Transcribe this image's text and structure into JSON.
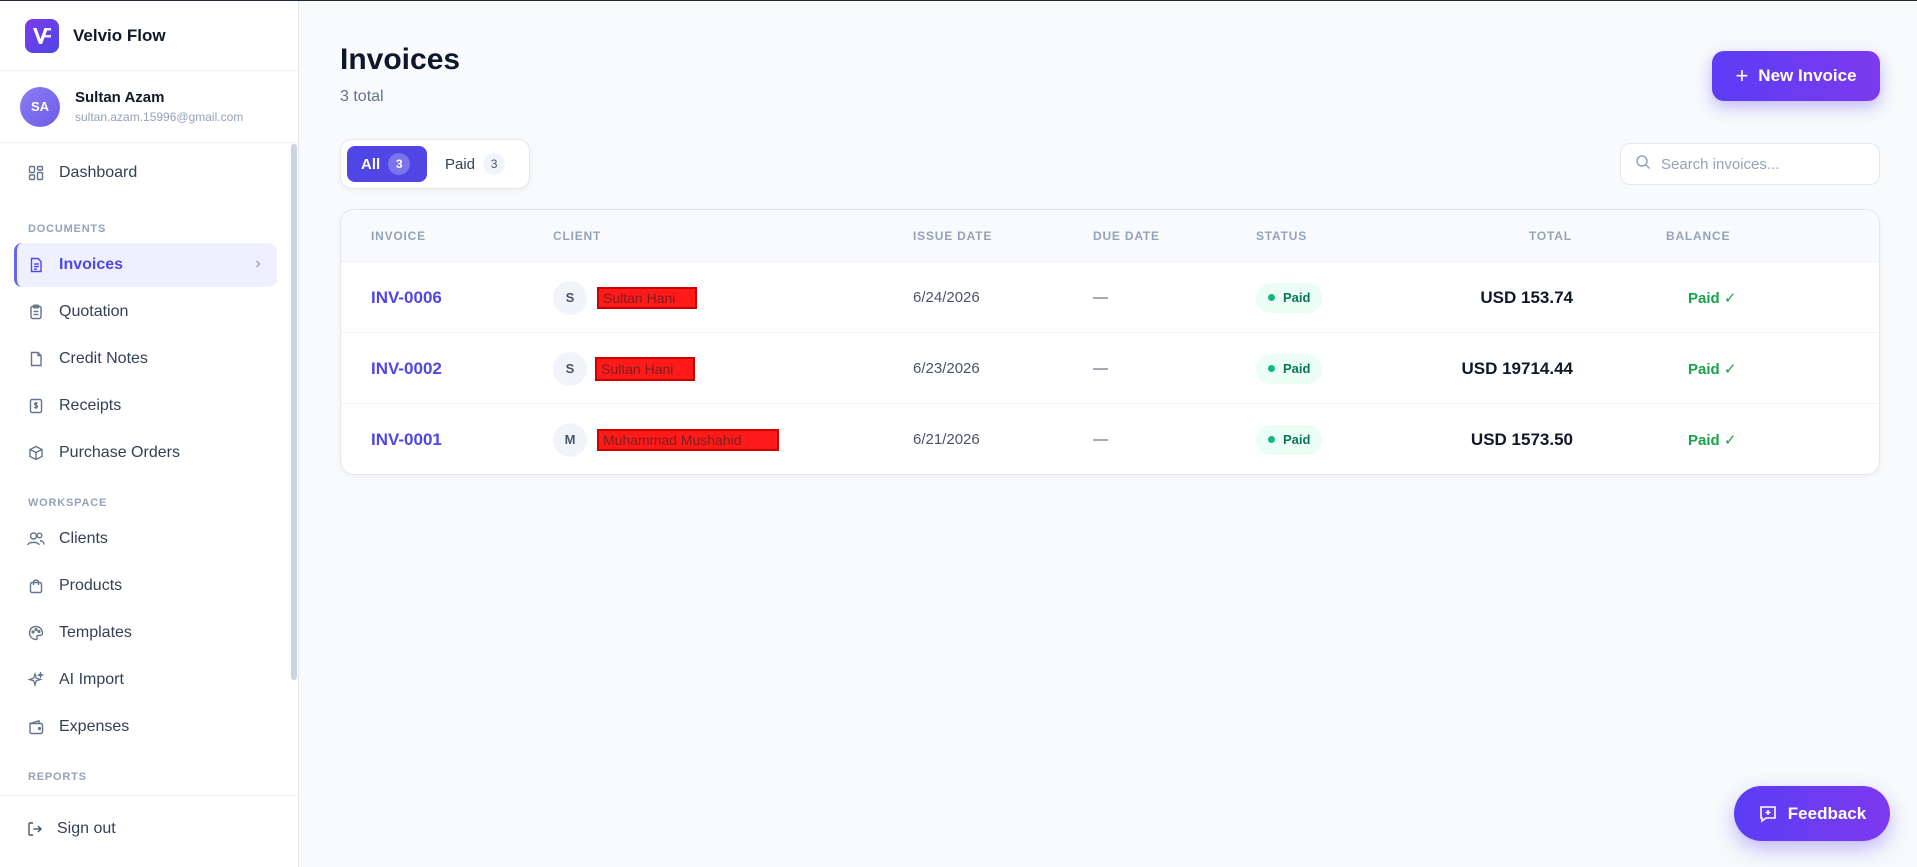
{
  "app": {
    "name": "Velvio Flow"
  },
  "user": {
    "initials": "SA",
    "name": "Sultan Azam",
    "email": "sultan.azam.15996@gmail.com"
  },
  "sidebar": {
    "dashboard": "Dashboard",
    "documents_label": "DOCUMENTS",
    "documents": [
      "Invoices",
      "Quotation",
      "Credit Notes",
      "Receipts",
      "Purchase Orders"
    ],
    "workspace_label": "WORKSPACE",
    "workspace": [
      "Clients",
      "Products",
      "Templates",
      "AI Import",
      "Expenses"
    ],
    "reports_label": "REPORTS",
    "sign_out": "Sign out",
    "active_item": "Invoices"
  },
  "page": {
    "title": "Invoices",
    "subtitle": "3 total",
    "new_button": "New Invoice"
  },
  "filters": {
    "all_label": "All",
    "all_count": "3",
    "paid_label": "Paid",
    "paid_count": "3"
  },
  "search": {
    "placeholder": "Search invoices..."
  },
  "table": {
    "headers": {
      "invoice": "INVOICE",
      "client": "CLIENT",
      "issue_date": "ISSUE DATE",
      "due_date": "DUE DATE",
      "status": "STATUS",
      "total": "TOTAL",
      "balance": "BALANCE"
    },
    "rows": [
      {
        "invoice": "INV-0006",
        "client_initial": "S",
        "client_name": "Sultan Hani",
        "issue_date": "6/24/2026",
        "due_date": "—",
        "status": "Paid",
        "total": "USD 153.74",
        "balance": "Paid ✓"
      },
      {
        "invoice": "INV-0002",
        "client_initial": "S",
        "client_name": "Sultan Hani",
        "issue_date": "6/23/2026",
        "due_date": "—",
        "status": "Paid",
        "total": "USD 19714.44",
        "balance": "Paid ✓"
      },
      {
        "invoice": "INV-0001",
        "client_initial": "M",
        "client_name": "Muhammad Mushahid",
        "issue_date": "6/21/2026",
        "due_date": "—",
        "status": "Paid",
        "total": "USD 1573.50",
        "balance": "Paid ✓"
      }
    ]
  },
  "feedback": {
    "label": "Feedback"
  },
  "colors": {
    "accent": "#4f46e5",
    "accent_gradient_start": "#5b3df5",
    "accent_gradient_end": "#7c3aed",
    "paid_green": "#16a34a",
    "redaction_red": "#ff1a1a"
  }
}
